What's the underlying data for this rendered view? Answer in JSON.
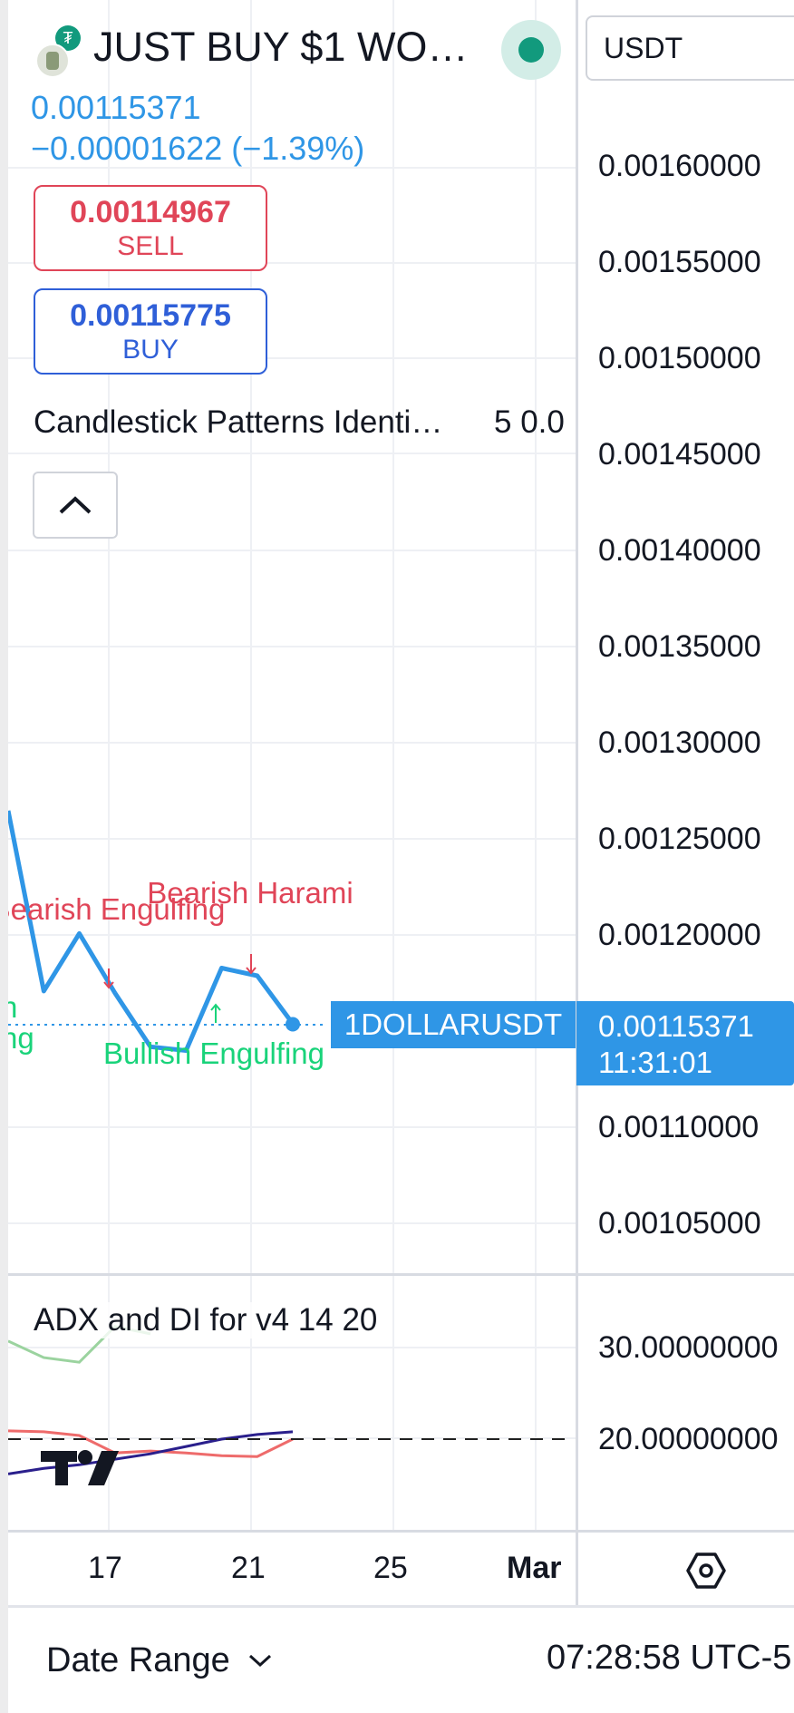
{
  "header": {
    "title": "JUST BUY $1 WO…",
    "last_price": "0.00115371",
    "change": "−0.00001622 (−1.39%)",
    "sell": {
      "value": "0.00114967",
      "label": "SELL"
    },
    "buy": {
      "value": "0.00115775",
      "label": "BUY"
    },
    "currency": "USDT",
    "status_color": "#129a7d"
  },
  "indicators": {
    "candlestick_title": "Candlestick Patterns Identi…",
    "candlestick_params": "5 0.0",
    "adx_title": "ADX and DI for v4 14 20"
  },
  "price_axis": [
    "0.00160000",
    "0.00155000",
    "0.00150000",
    "0.00145000",
    "0.00140000",
    "0.00135000",
    "0.00130000",
    "0.00125000",
    "0.00120000",
    "0.00110000",
    "0.00105000"
  ],
  "adx_axis": [
    "30.00000000",
    "20.00000000"
  ],
  "time_axis": [
    "17",
    "21",
    "25",
    "Mar"
  ],
  "markers": {
    "bear1": "Bearish Engulfing",
    "bear2": "Bearish Harami",
    "bull1": "Bullish Engulfing",
    "bull_cut": "n",
    "bull_cut2": "ng"
  },
  "price_tag": {
    "symbol": "1DOLLARUSDT",
    "price": "0.00115371",
    "countdown": "11:31:01"
  },
  "footer": {
    "date_range": "Date Range",
    "clock": "07:28:58 UTC-5"
  },
  "chart_data": {
    "type": "line",
    "series": [
      {
        "values": [
          0.001265,
          0.001171,
          0.001201,
          0.00117,
          0.001142,
          0.00114,
          0.001183,
          0.001179,
          0.001154
        ]
      }
    ],
    "ylim": [
      0.001,
      0.00164
    ],
    "last_value": 0.00115371,
    "adx_ylim": [
      10,
      35
    ],
    "adx_series": [
      {
        "values": [
          30.7,
          28.9,
          28.4,
          32.3,
          31.5
        ]
      },
      {
        "values": [
          20.9,
          20.8,
          20.4,
          18.5,
          18.7,
          18.5,
          18.2,
          18.1,
          20.0
        ]
      },
      {
        "values": [
          16.2,
          16.8,
          17.2,
          17.8,
          18.4,
          19.2,
          20.0,
          20.5,
          20.8
        ]
      }
    ],
    "adx_threshold": 20
  }
}
